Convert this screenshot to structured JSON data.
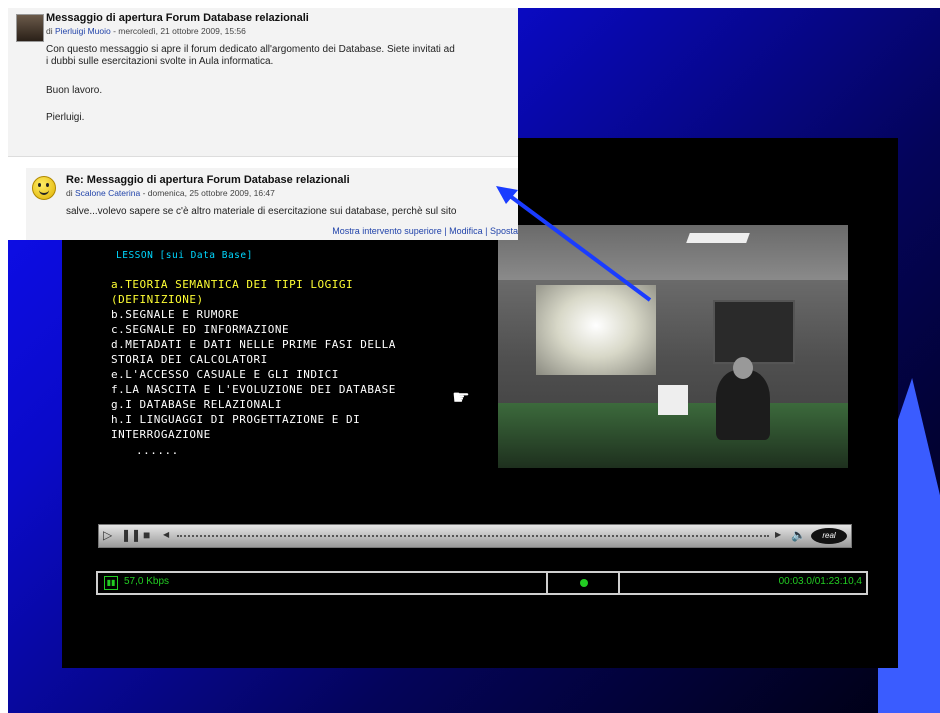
{
  "forum": {
    "post1": {
      "title": "Messaggio di apertura Forum Database relazionali",
      "meta_prefix": "di ",
      "author": "Pierluigi Muoio",
      "meta_date": " - mercoledì, 21 ottobre 2009, 15:56",
      "line1": "Con questo messaggio si apre il forum dedicato all'argomento dei Database. Siete invitati ad",
      "line2": "i dubbi sulle esercitazioni svolte in Aula informatica.",
      "line3": "Buon lavoro.",
      "line4": "Pierluigi."
    },
    "post2": {
      "title": "Re: Messaggio di apertura Forum Database relazionali",
      "meta_prefix": "di ",
      "author": "Scalone Caterina",
      "meta_date": " - domenica, 25 ottobre 2009, 16:47",
      "line1": "salve...volevo sapere se c'è altro materiale di esercitazione sui database, perchè sul sito",
      "links": "Mostra intervento superiore | Modifica | Sposta"
    }
  },
  "lesson": {
    "title": "LESSON [sui Data Base]",
    "lines": [
      "a.TEORIA SEMANTICA DEI TIPI LOGIGI",
      "(DEFINIZIONE)",
      "b.SEGNALE E RUMORE",
      "c.SEGNALE ED INFORMAZIONE",
      "d.METADATI E DATI NELLE PRIME FASI DELLA",
      "STORIA DEI CALCOLATORI",
      "e.L'ACCESSO CASUALE E GLI INDICI",
      "f.LA NASCITA E L'EVOLUZIONE DEI DATABASE",
      "g.I DATABASE RELAZIONALI",
      "h.I LINGUAGGI DI PROGETTAZIONE E DI",
      "INTERROGAZIONE",
      "......"
    ]
  },
  "player": {
    "bitrate": "57,0 Kbps",
    "time": "00:03.0/01:23:10,4",
    "logo": "real"
  },
  "colors": {
    "lesson_title": "#00d8ff",
    "lesson_highlight": "#ffff33",
    "status_green": "#22cc22",
    "arrow": "#1a3cff"
  }
}
